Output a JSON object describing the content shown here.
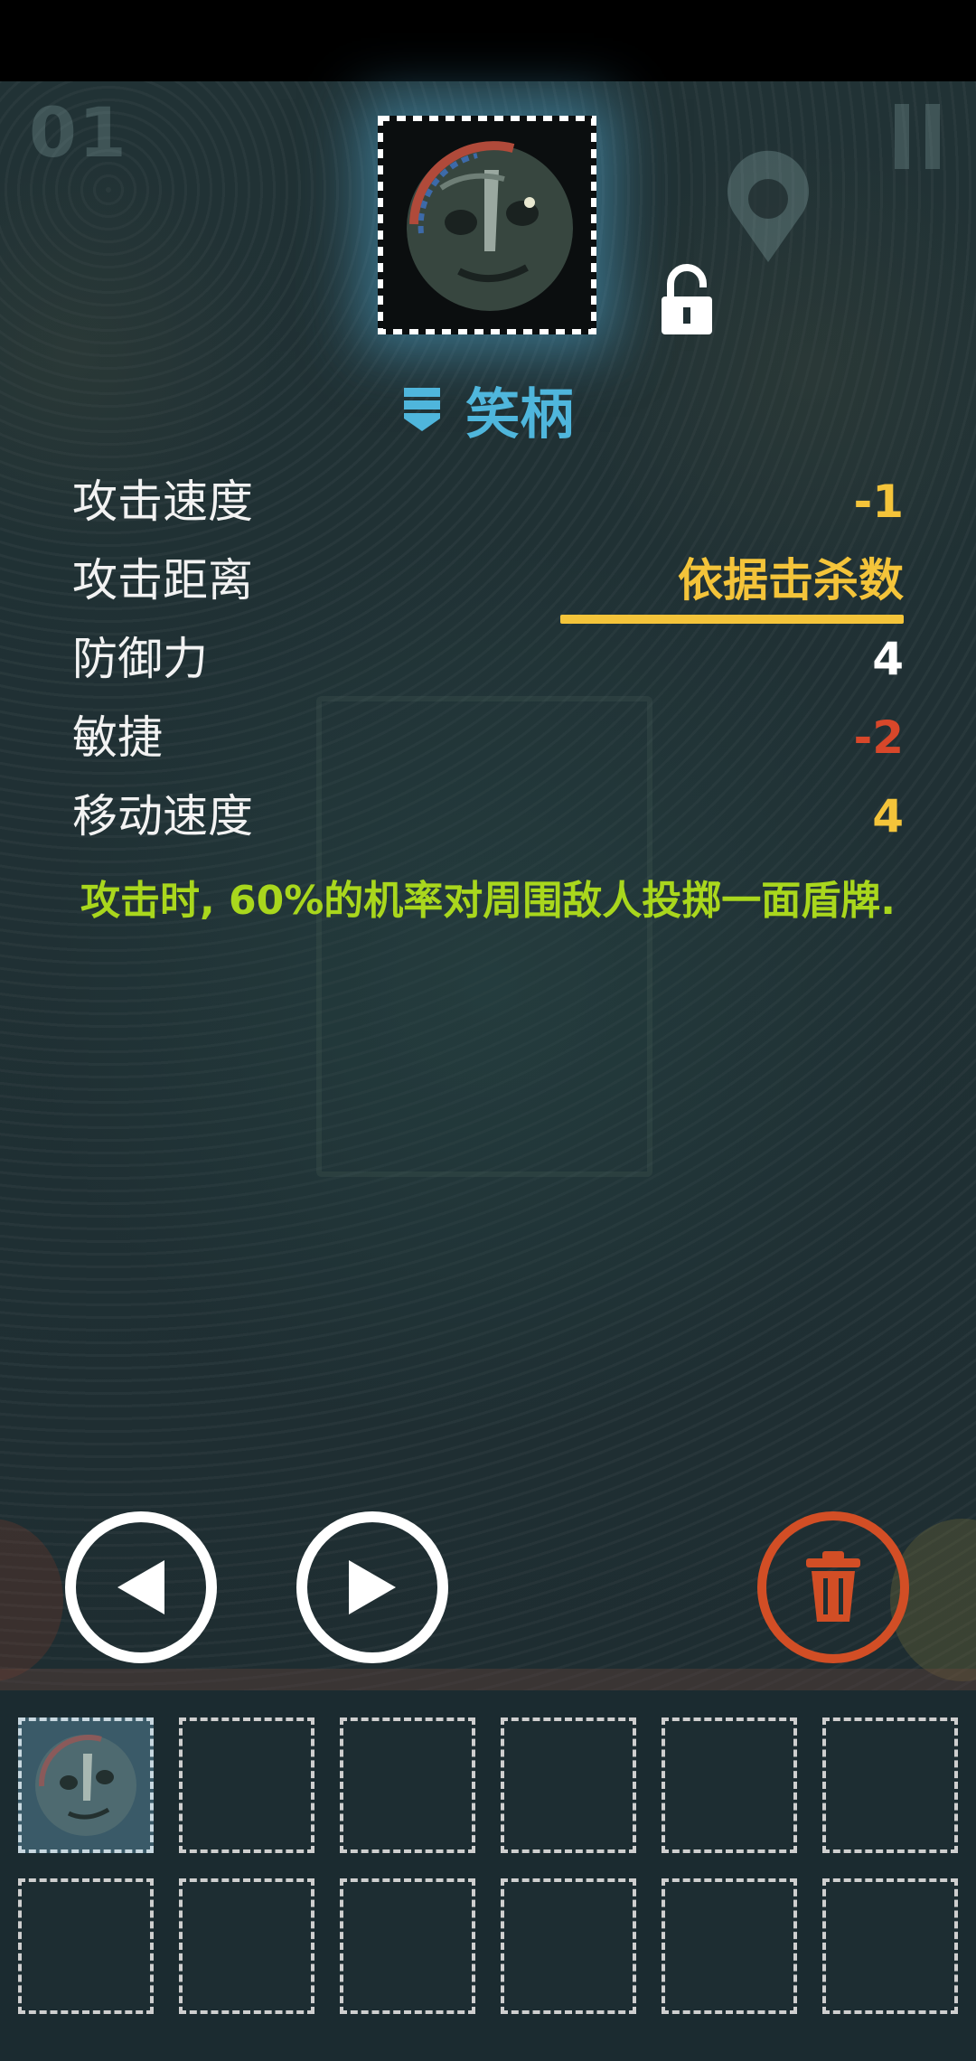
{
  "hud": {
    "level_counter": "01"
  },
  "item": {
    "name": "笑柄",
    "icon": "stone-face-mask-icon",
    "locked": false,
    "portrait_glow_color": "#4fb6dc"
  },
  "stats": [
    {
      "label": "攻击速度",
      "value": "-1",
      "color": "#f4c43a"
    },
    {
      "label": "攻击距离",
      "value": "依据击杀数",
      "color": "#f4c43a"
    },
    {
      "label": "防御力",
      "value": "4",
      "color": "#ffffff"
    },
    {
      "label": "敏捷",
      "value": "-2",
      "color": "#d8472a"
    },
    {
      "label": "移动速度",
      "value": "4",
      "color": "#f4c43a"
    }
  ],
  "effect_text": "攻击时, 60%的机率对周围敌人投掷一面盾牌.",
  "colors": {
    "title": "#4fb6dc",
    "effect": "#a9d71d",
    "trash": "#d24e25"
  },
  "inventory": {
    "slots_total": 12,
    "filled": [
      0
    ]
  }
}
